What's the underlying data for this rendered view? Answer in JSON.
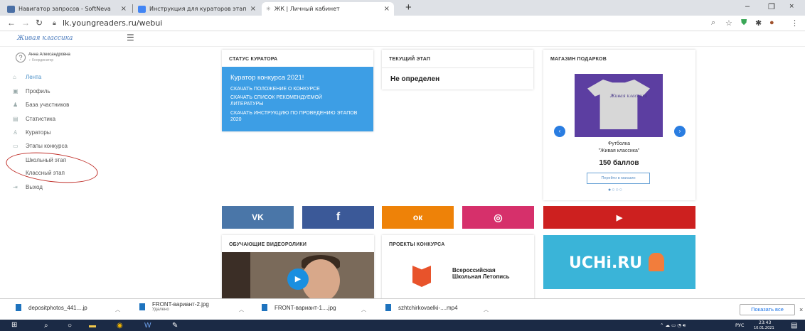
{
  "browser": {
    "tabs": [
      {
        "title": "Навигатор запросов - SoftNeva",
        "icon_color": "#4a6fa5"
      },
      {
        "title": "Инструкция для кураторов этап",
        "icon_color": "#4285f4"
      },
      {
        "title": "ЖК | Личный кабинет",
        "icon_color": "#ffffff"
      }
    ],
    "tab_close": "×",
    "new_tab": "+",
    "url": "lk.youngreaders.ru/webui",
    "window_controls": [
      "–",
      "❐",
      "×"
    ]
  },
  "app": {
    "logo": "Живая классика"
  },
  "sidebar": {
    "user_name": "Анна Александровна",
    "user_sub": "♀ Координатор",
    "items": [
      {
        "label": "Лента",
        "icon": "home-icon",
        "active": true
      },
      {
        "label": "Профиль",
        "icon": "profile-icon",
        "active": false
      },
      {
        "label": "База участников",
        "icon": "users-icon",
        "active": false
      },
      {
        "label": "Статистика",
        "icon": "stats-icon",
        "active": false
      },
      {
        "label": "Кураторы",
        "icon": "curators-icon",
        "active": false
      },
      {
        "label": "Этапы конкурса",
        "icon": "stages-icon",
        "active": false
      },
      {
        "label": "Школьный этап",
        "icon": "",
        "active": false
      },
      {
        "label": "Классный этап",
        "icon": "",
        "active": false
      },
      {
        "label": "Выход",
        "icon": "logout-icon",
        "active": false
      }
    ]
  },
  "curator_card": {
    "title": "СТАТУС КУРАТОРА",
    "heading": "Куратор конкурса 2021!",
    "links": [
      "СКАЧАТЬ ПОЛОЖЕНИЕ О КОНКУРСЕ",
      "СКАЧАТЬ СПИСОК РЕКОМЕНДУЕМОЙ ЛИТЕРАТУРЫ",
      "СКАЧАТЬ ИНСТРУКЦИЮ ПО ПРОВЕДЕНИЮ ЭТАПОВ 2020"
    ],
    "panel_color": "#3d9ee5"
  },
  "stage_card": {
    "title": "ТЕКУЩИЙ ЭТАП",
    "value": "Не определен"
  },
  "shop_card": {
    "title": "МАГАЗИН ПОДАРКОВ",
    "shirt_text": "Живая классика",
    "product_line1": "Футболка",
    "product_line2": "\"Живая классика\"",
    "price": "150 баллов",
    "button": "Перейти в магазин",
    "dots": "●○○○"
  },
  "social": [
    {
      "name": "vk",
      "glyph": "VK",
      "color": "#4a76a8"
    },
    {
      "name": "facebook",
      "glyph": "f",
      "color": "#3b5998"
    },
    {
      "name": "odnoklassniki",
      "glyph": "ок",
      "color": "#ee8208"
    },
    {
      "name": "instagram",
      "glyph": "◎",
      "color": "#d6306b"
    },
    {
      "name": "youtube",
      "glyph": "▶",
      "color": "#cd201f"
    }
  ],
  "video_card": {
    "title": "ОБУЧАЮЩИЕ ВИДЕОРОЛИКИ"
  },
  "projects_card": {
    "title": "ПРОЕКТЫ КОНКУРСА",
    "letopis": "Всероссийская Школьная Летопись"
  },
  "uchi": {
    "text": "UCHi.RU"
  },
  "downloads": {
    "items": [
      {
        "name": "depositphotos_441....jp",
        "sub": ""
      },
      {
        "name": "FRONT-вариант-2.jpg",
        "sub": "Удалено"
      },
      {
        "name": "FRONT-вариант-1....jpg",
        "sub": ""
      },
      {
        "name": "szhtchirkovaelki-....mp4",
        "sub": ""
      }
    ],
    "show_all": "Показать все",
    "close": "×"
  },
  "taskbar": {
    "lang": "РУС",
    "time": "23:43",
    "date": "10.01.2021"
  }
}
